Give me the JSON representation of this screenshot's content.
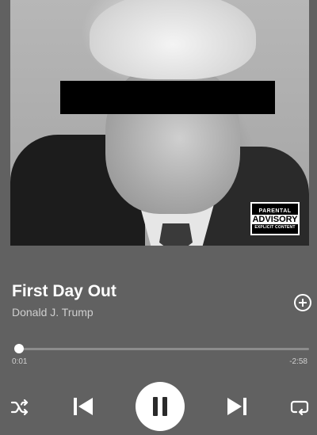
{
  "track": {
    "title": "First Day Out",
    "artist": "Donald J. Trump"
  },
  "album_art": {
    "parental_advisory": {
      "line1": "PARENTAL",
      "line2": "ADVISORY",
      "line3": "EXPLICIT CONTENT"
    }
  },
  "playback": {
    "elapsed": "0:01",
    "remaining": "-2:58",
    "progress_fraction": 0.006,
    "state": "playing"
  },
  "icons": {
    "add": "plus-circle-icon",
    "shuffle": "shuffle-icon",
    "previous": "skip-previous-icon",
    "pause": "pause-icon",
    "next": "skip-next-icon",
    "repeat": "repeat-icon"
  },
  "colors": {
    "background": "#616161",
    "accent": "#ffffff"
  }
}
